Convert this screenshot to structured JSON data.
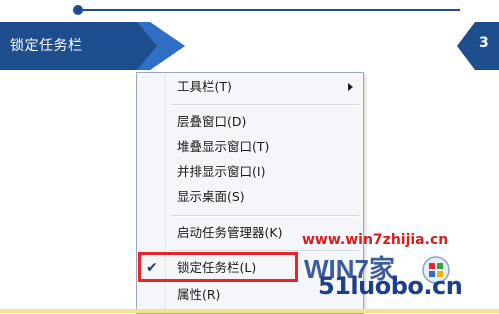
{
  "header": {
    "title": "锁定任务栏",
    "page_number": "3"
  },
  "colors": {
    "banner": "#1f4e8f",
    "banner_light": "#2f6fc4",
    "highlight": "#e8232a",
    "watermark_url": "#d61c1c",
    "watermark_site": "#1c3f8a"
  },
  "context_menu": {
    "toolbars": "工具栏(T)",
    "cascade": "层叠窗口(D)",
    "stacked": "堆叠显示窗口(T)",
    "side_by_side": "并排显示窗口(I)",
    "show_desktop": "显示桌面(S)",
    "task_manager": "启动任务管理器(K)",
    "lock_taskbar": "锁定任务栏(L)",
    "lock_taskbar_checked": true,
    "properties": "属性(R)"
  },
  "watermark": {
    "url": "www.win7zhijia.cn",
    "logo_text": "WIN7家",
    "site": "51luobo.cn"
  }
}
